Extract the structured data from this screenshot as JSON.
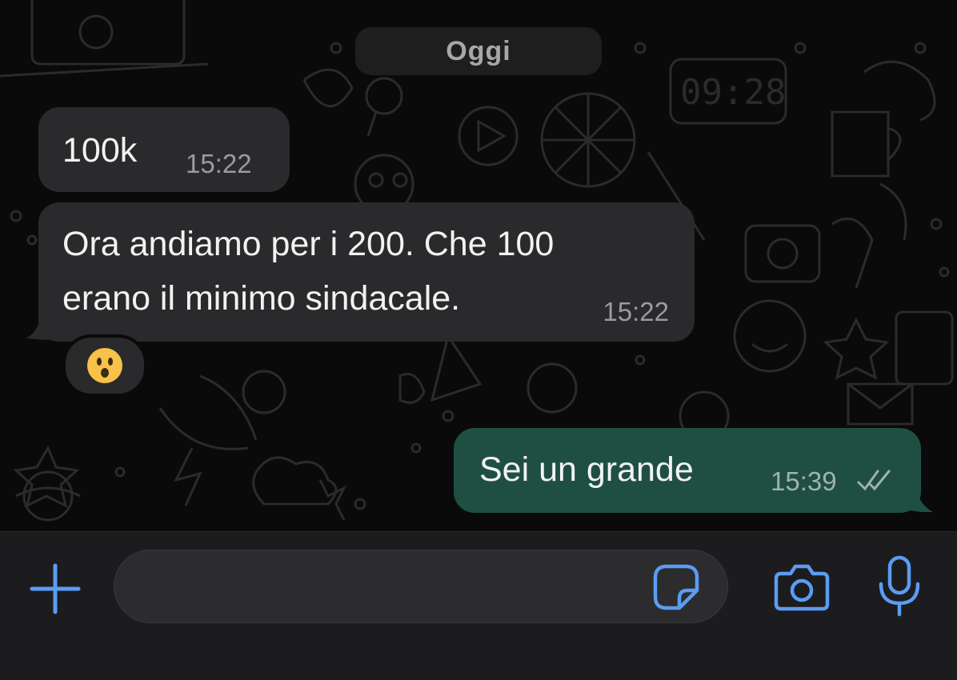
{
  "chat": {
    "date_separator": "Oggi",
    "messages": [
      {
        "direction": "incoming",
        "text": "100k",
        "time": "15:22"
      },
      {
        "direction": "incoming",
        "text": "Ora andiamo per i 200. Che 100\nerano il minimo sindacale.",
        "time": "15:22",
        "reaction": "😮"
      },
      {
        "direction": "outgoing",
        "text": "Sei un grande",
        "time": "15:39",
        "status": "read-double-check"
      }
    ],
    "wallpaper_clock": "09:28"
  },
  "composer": {
    "input_value": "",
    "input_placeholder": "",
    "icons": [
      "plus-icon",
      "sticker-icon",
      "camera-icon",
      "microphone-icon"
    ]
  },
  "colors": {
    "incoming_bubble": "#2a2a2c",
    "outgoing_bubble": "#1f4f43",
    "accent": "#5b9cf2",
    "background": "#0a0a0a"
  }
}
